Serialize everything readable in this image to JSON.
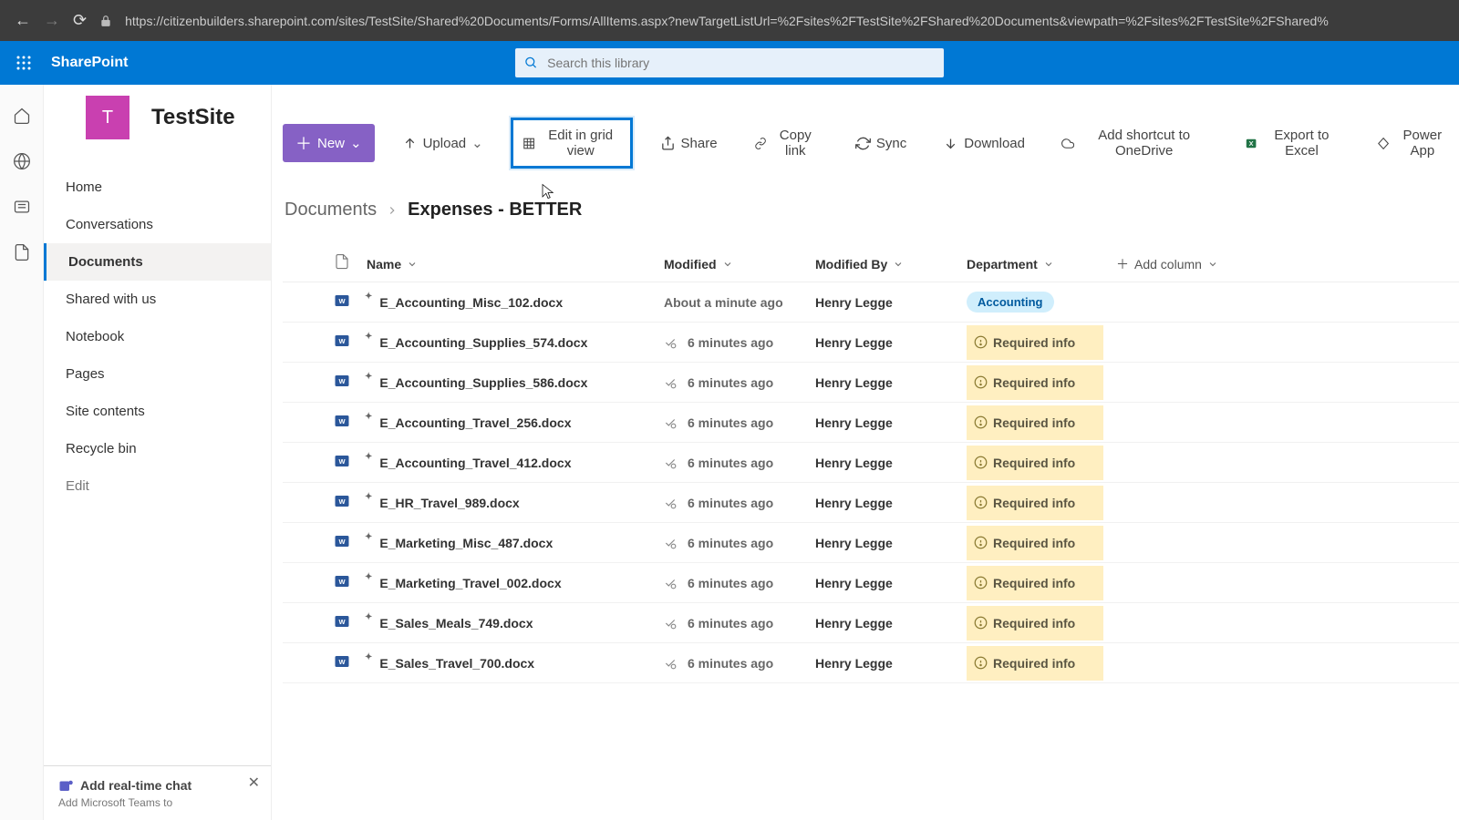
{
  "browser": {
    "url": "https://citizenbuilders.sharepoint.com/sites/TestSite/Shared%20Documents/Forms/AllItems.aspx?newTargetListUrl=%2Fsites%2FTestSite%2FShared%20Documents&viewpath=%2Fsites%2FTestSite%2FShared%"
  },
  "suite": {
    "app_name": "SharePoint",
    "search_placeholder": "Search this library"
  },
  "site": {
    "tile_letter": "T",
    "title": "TestSite"
  },
  "nav": {
    "items": [
      {
        "label": "Home"
      },
      {
        "label": "Conversations"
      },
      {
        "label": "Documents",
        "active": true
      },
      {
        "label": "Shared with us"
      },
      {
        "label": "Notebook"
      },
      {
        "label": "Pages"
      },
      {
        "label": "Site contents"
      },
      {
        "label": "Recycle bin"
      },
      {
        "label": "Edit",
        "muted": true
      }
    ],
    "teams": {
      "title": "Add real-time chat",
      "desc": "Add Microsoft Teams to"
    }
  },
  "toolbar": {
    "new_label": "New",
    "upload": "Upload",
    "edit_grid": "Edit in grid view",
    "share": "Share",
    "copy": "Copy link",
    "sync": "Sync",
    "download": "Download",
    "shortcut": "Add shortcut to OneDrive",
    "export": "Export to Excel",
    "power": "Power App"
  },
  "breadcrumb": {
    "library": "Documents",
    "folder": "Expenses - BETTER"
  },
  "columns": {
    "name": "Name",
    "modified": "Modified",
    "modified_by": "Modified By",
    "department": "Department",
    "add": "Add column"
  },
  "rows": [
    {
      "name": "E_Accounting_Misc_102.docx",
      "modified": "About a minute ago",
      "by": "Henry Legge",
      "dept": "Accounting",
      "required": false,
      "checkout": false
    },
    {
      "name": "E_Accounting_Supplies_574.docx",
      "modified": "6 minutes ago",
      "by": "Henry Legge",
      "dept": "",
      "required": true,
      "checkout": true
    },
    {
      "name": "E_Accounting_Supplies_586.docx",
      "modified": "6 minutes ago",
      "by": "Henry Legge",
      "dept": "",
      "required": true,
      "checkout": true
    },
    {
      "name": "E_Accounting_Travel_256.docx",
      "modified": "6 minutes ago",
      "by": "Henry Legge",
      "dept": "",
      "required": true,
      "checkout": true
    },
    {
      "name": "E_Accounting_Travel_412.docx",
      "modified": "6 minutes ago",
      "by": "Henry Legge",
      "dept": "",
      "required": true,
      "checkout": true
    },
    {
      "name": "E_HR_Travel_989.docx",
      "modified": "6 minutes ago",
      "by": "Henry Legge",
      "dept": "",
      "required": true,
      "checkout": true
    },
    {
      "name": "E_Marketing_Misc_487.docx",
      "modified": "6 minutes ago",
      "by": "Henry Legge",
      "dept": "",
      "required": true,
      "checkout": true
    },
    {
      "name": "E_Marketing_Travel_002.docx",
      "modified": "6 minutes ago",
      "by": "Henry Legge",
      "dept": "",
      "required": true,
      "checkout": true
    },
    {
      "name": "E_Sales_Meals_749.docx",
      "modified": "6 minutes ago",
      "by": "Henry Legge",
      "dept": "",
      "required": true,
      "checkout": true
    },
    {
      "name": "E_Sales_Travel_700.docx",
      "modified": "6 minutes ago",
      "by": "Henry Legge",
      "dept": "",
      "required": true,
      "checkout": true
    }
  ],
  "required_label": "Required info"
}
